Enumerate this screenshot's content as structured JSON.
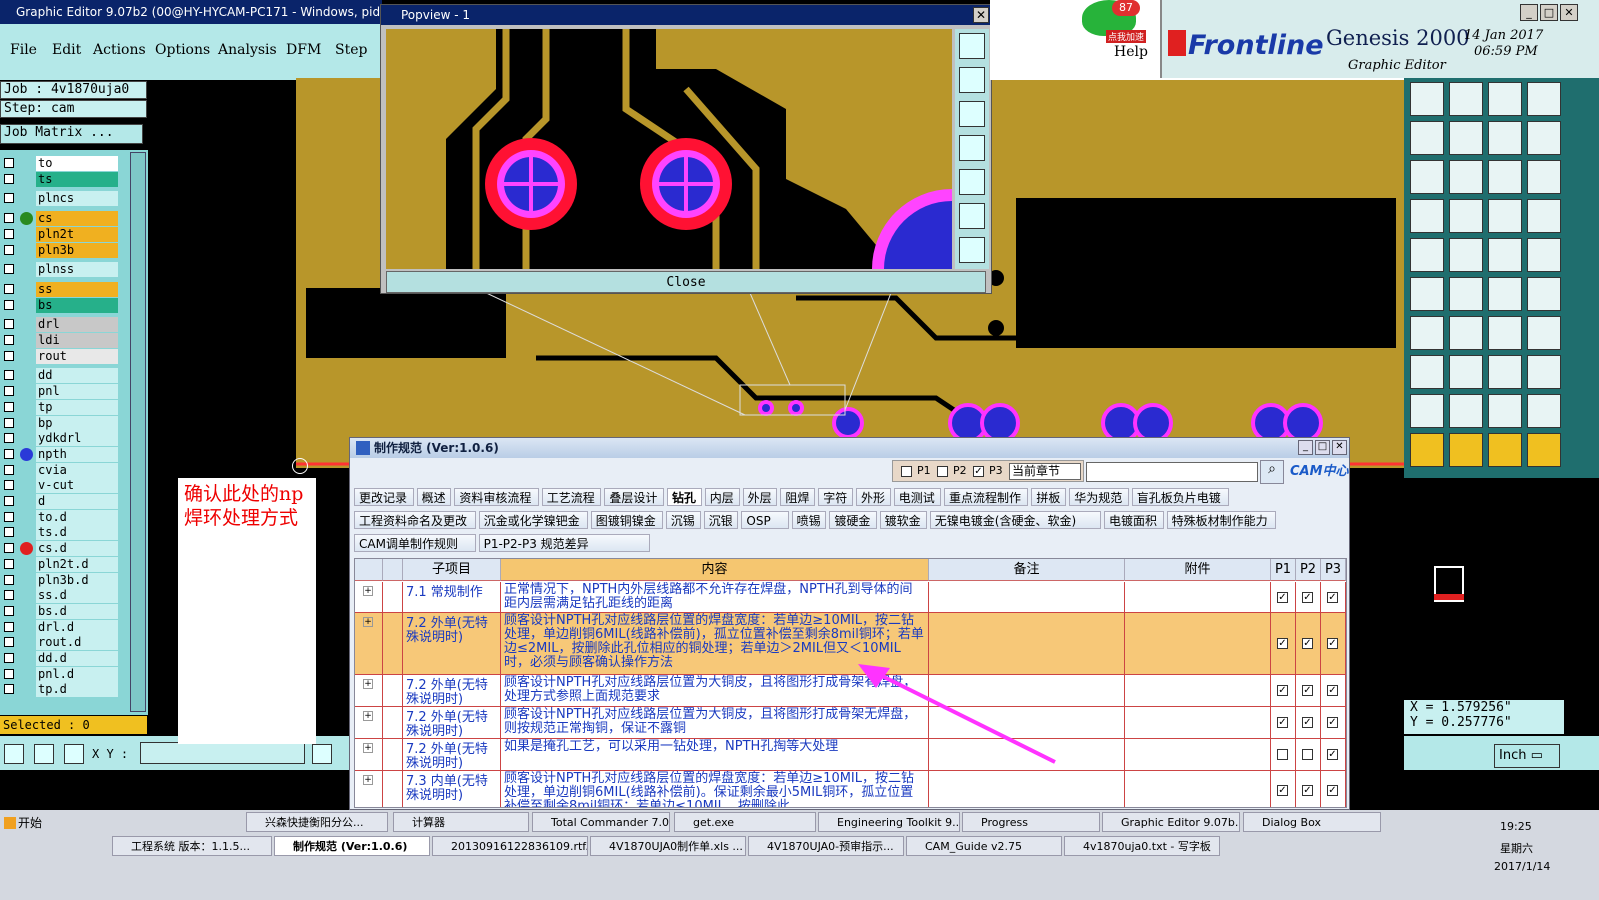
{
  "window": {
    "title": "Graphic Editor 9.07b2 (00@HY-HYCAM-PC171 - Windows, pid:5764"
  },
  "menu": [
    "File",
    "Edit",
    "Actions",
    "Options",
    "Analysis",
    "DFM",
    "Step"
  ],
  "job": {
    "label": "Job : 4v1870uja0",
    "step": "Step: cam",
    "matrix": "Job Matrix ..."
  },
  "layers": [
    {
      "name": "to",
      "color": "#ffffff"
    },
    {
      "name": "ts",
      "color": "#26b08a"
    },
    {
      "name": "plncs",
      "color": "#c8f0f0"
    },
    {
      "name": "cs",
      "color": "#f0b020"
    },
    {
      "name": "pln2t",
      "color": "#f0b020"
    },
    {
      "name": "pln3b",
      "color": "#f0b020"
    },
    {
      "name": "plnss",
      "color": "#c8f0f0"
    },
    {
      "name": "ss",
      "color": "#f0b020"
    },
    {
      "name": "bs",
      "color": "#26b08a"
    },
    {
      "name": "drl",
      "color": "#c8c8c8"
    },
    {
      "name": "ldi",
      "color": "#c8c8c8"
    },
    {
      "name": "rout",
      "color": "#e8e8e8"
    },
    {
      "name": "dd",
      "color": "#c8f0f0"
    },
    {
      "name": "pnl",
      "color": "#c8f0f0"
    },
    {
      "name": "tp",
      "color": "#c8f0f0"
    },
    {
      "name": "bp",
      "color": "#c8f0f0"
    },
    {
      "name": "ydkdrl",
      "color": "#c8f0f0"
    },
    {
      "name": "npth",
      "color": "#c8f0f0"
    },
    {
      "name": "cvia",
      "color": "#c8f0f0"
    },
    {
      "name": "v-cut",
      "color": "#c8f0f0"
    },
    {
      "name": "d",
      "color": "#c8f0f0"
    },
    {
      "name": "to.d",
      "color": "#c8f0f0"
    },
    {
      "name": "ts.d",
      "color": "#c8f0f0"
    },
    {
      "name": "cs.d",
      "color": "#c8f0f0"
    },
    {
      "name": "pln2t.d",
      "color": "#c8f0f0"
    },
    {
      "name": "pln3b.d",
      "color": "#c8f0f0"
    },
    {
      "name": "ss.d",
      "color": "#c8f0f0"
    },
    {
      "name": "bs.d",
      "color": "#c8f0f0"
    },
    {
      "name": "drl.d",
      "color": "#c8f0f0"
    },
    {
      "name": "rout.d",
      "color": "#c8f0f0"
    },
    {
      "name": "dd.d",
      "color": "#c8f0f0"
    },
    {
      "name": "pnl.d",
      "color": "#c8f0f0"
    },
    {
      "name": "tp.d",
      "color": "#c8f0f0"
    }
  ],
  "selected": "Selected : 0",
  "xy_label": "X Y :",
  "popview": {
    "title": "Popview - 1",
    "close": "Close"
  },
  "brand": {
    "help": "Help",
    "helper_badge": "87",
    "helper_tip": "点我加速",
    "frontline": "Frontline",
    "genesis": "Genesis 2000",
    "graphic_editor": "Graphic Editor",
    "date": "14 Jan 2017",
    "time": "06:59 PM"
  },
  "coords": {
    "x": "X = 1.579256\"",
    "y": "Y = 0.257776\""
  },
  "units": "Inch",
  "note": "确认此处的np焊环处理方式",
  "dialog": {
    "title": "制作规范 (Ver:1.0.6)",
    "filters": [
      "P1",
      "P2",
      "P3"
    ],
    "scope": "当前章节",
    "logo": "CAM中心",
    "tabs_row1": [
      "更改记录",
      "概述",
      "资料审核流程",
      "工艺流程",
      "叠层设计",
      "钻孔",
      "内层",
      "外层",
      "阻焊",
      "字符",
      "外形",
      "电测试",
      "重点流程制作",
      "拼板",
      "华为规范",
      "盲孔板负片电镀"
    ],
    "tabs_row2": [
      "工程资料命名及更改",
      "沉金或化学镍钯金",
      "图镀铜镍金",
      "沉锡",
      "沉银",
      "OSP",
      "喷锡",
      "镀硬金",
      "镀软金",
      "无镍电镀金(含硬金、软金)",
      "电镀面积",
      "特殊板材制作能力"
    ],
    "tabs_row3": [
      "CAM调单制作规则",
      "P1-P2-P3 规范差异"
    ],
    "columns": [
      "子项目",
      "内容",
      "备注",
      "附件",
      "P1",
      "P2",
      "P3"
    ],
    "rows": [
      {
        "item": "7.1 常规制作",
        "content": "正常情况下，NPTH内外层线路都不允许存在焊盘，NPTH孔到导体的间距内层需满足钻孔距线的距离",
        "p": [
          true,
          true,
          true
        ]
      },
      {
        "item": "7.2 外单(无特殊说明时)",
        "content": "顾客设计NPTH孔对应线路层位置的焊盘宽度：若单边≥10MIL，按二钻处理，单边削铜6MIL(线路补偿前)，孤立位置补偿至剩余8mil铜环；若单边≤2MIL，按删除此孔位相应的铜处理；若单边＞2MIL但又＜10MIL时，必须与顾客确认操作方法",
        "p": [
          true,
          true,
          true
        ]
      },
      {
        "item": "7.2 外单(无特殊说明时)",
        "content": "顾客设计NPTH孔对应线路层位置为大铜皮，且将图形打成骨架有焊盘，处理方式参照上面规范要求",
        "p": [
          true,
          true,
          true
        ]
      },
      {
        "item": "7.2 外单(无特殊说明时)",
        "content": "顾客设计NPTH孔对应线路层位置为大铜皮，且将图形打成骨架无焊盘，则按规范正常掏铜，保证不露铜",
        "p": [
          true,
          true,
          true
        ]
      },
      {
        "item": "7.2 外单(无特殊说明时)",
        "content": "如果是掩孔工艺，可以采用一钻处理，NPTH孔掏等大处理",
        "p": [
          false,
          false,
          true
        ]
      },
      {
        "item": "7.3 内单(无特殊说明时)",
        "content": "顾客设计NPTH孔对应线路层位置的焊盘宽度：若单边≥10MIL，按二钻处理，单边削铜6MIL(线路补偿前)。保证剩余最小5MIL铜环，孤立位置补偿至剩余8mil铜环；若单边≤10MIL，按删除此",
        "p": [
          true,
          true,
          true
        ]
      }
    ]
  },
  "taskbar": {
    "start": "开始",
    "row1": [
      "兴森快捷衡阳分公...",
      "计算器",
      "Total Commander 7.0...",
      "get.exe",
      "Engineering Toolkit 9....",
      "Progress",
      "Graphic Editor 9.07b...",
      "Dialog Box"
    ],
    "row2": [
      "工程系统  版本：1.1.5...",
      "制作规范 (Ver:1.0.6)",
      "20130916122836109.rtf...",
      "4V1870UJA0制作单.xls ...",
      "4V1870UJA0-预审指示...",
      "CAM_Guide v2.75",
      "4v1870uja0.txt - 写字板"
    ],
    "clock": "19:25",
    "weekday": "星期六",
    "date": "2017/1/14"
  },
  "colors": {
    "copper": "#b8962a",
    "panel_cyan": "#b4e8e8",
    "accent_pink": "#ff33ff"
  }
}
